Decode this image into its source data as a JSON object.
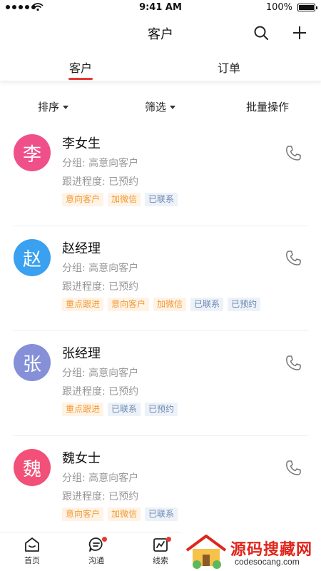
{
  "status_bar": {
    "time": "9:41 AM",
    "battery": "100%"
  },
  "header": {
    "title": "客户"
  },
  "tabs": [
    {
      "label": "客户"
    },
    {
      "label": "订单"
    }
  ],
  "filters": {
    "sort": "排序",
    "filter": "筛选",
    "batch": "批量操作"
  },
  "customers": [
    {
      "avatar": "李",
      "avatar_color": "#f0508a",
      "name": "李女生",
      "group": "分组: 高意向客户",
      "progress": "跟进程度: 已预约",
      "tags": [
        {
          "text": "意向客户",
          "style": "orange"
        },
        {
          "text": "加微信",
          "style": "orange"
        },
        {
          "text": "已联系",
          "style": "blue"
        }
      ]
    },
    {
      "avatar": "赵",
      "avatar_color": "#3aa0f0",
      "name": "赵经理",
      "group": "分组: 高意向客户",
      "progress": "跟进程度: 已预约",
      "tags": [
        {
          "text": "重点跟进",
          "style": "orange"
        },
        {
          "text": "意向客户",
          "style": "orange"
        },
        {
          "text": "加微信",
          "style": "orange"
        },
        {
          "text": "已联系",
          "style": "blue"
        },
        {
          "text": "已预约",
          "style": "blue"
        }
      ]
    },
    {
      "avatar": "张",
      "avatar_color": "#8590d8",
      "name": "张经理",
      "group": "分组: 高意向客户",
      "progress": "跟进程度: 已预约",
      "tags": [
        {
          "text": "重点跟进",
          "style": "orange"
        },
        {
          "text": "已联系",
          "style": "blue"
        },
        {
          "text": "已预约",
          "style": "blue"
        }
      ]
    },
    {
      "avatar": "魏",
      "avatar_color": "#f25078",
      "name": "魏女士",
      "group": "分组: 高意向客户",
      "progress": "跟进程度: 已预约",
      "tags": [
        {
          "text": "意向客户",
          "style": "orange"
        },
        {
          "text": "加微信",
          "style": "orange"
        },
        {
          "text": "已联系",
          "style": "blue"
        }
      ]
    }
  ],
  "bottom_nav": [
    {
      "label": "首页",
      "icon": "home-icon"
    },
    {
      "label": "沟通",
      "icon": "chat-icon"
    },
    {
      "label": "线索",
      "icon": "clue-icon"
    }
  ],
  "watermark": {
    "title": "源码搜藏网",
    "url": "codesocang.com"
  },
  "colors": {
    "accent": "#e53935",
    "tag_orange": "#f29b38",
    "tag_blue": "#6c89b3"
  }
}
